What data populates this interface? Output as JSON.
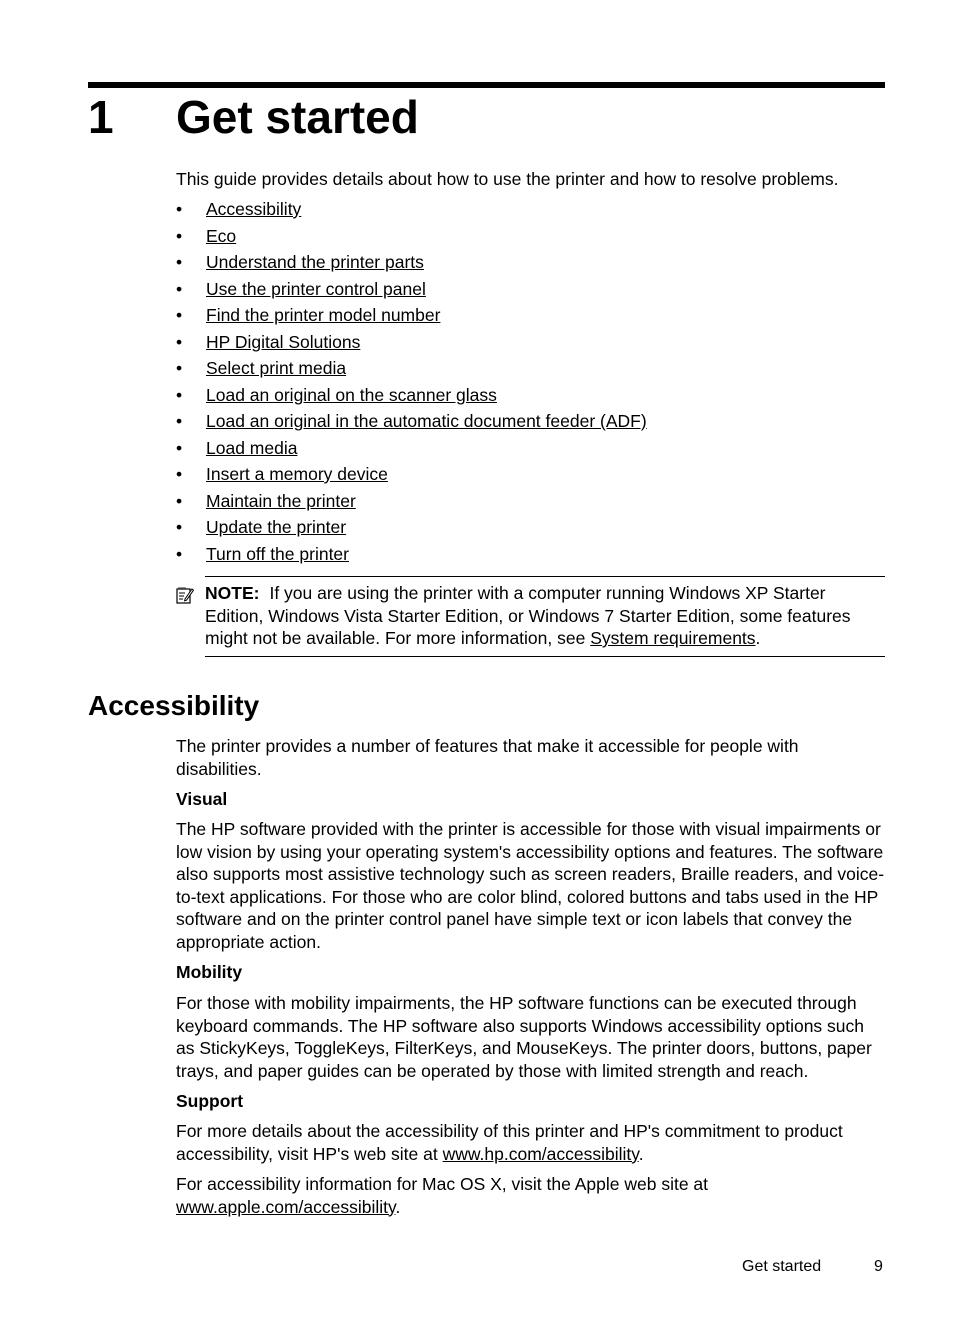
{
  "chapter": {
    "number": "1",
    "title": "Get started"
  },
  "intro": "This guide provides details about how to use the printer and how to resolve problems.",
  "toc": [
    "Accessibility",
    "Eco",
    "Understand the printer parts",
    "Use the printer control panel",
    "Find the printer model number",
    "HP Digital Solutions",
    "Select print media",
    "Load an original on the scanner glass",
    "Load an original in the automatic document feeder (ADF)",
    "Load media",
    "Insert a memory device",
    "Maintain the printer",
    "Update the printer",
    "Turn off the printer"
  ],
  "bullet": "•",
  "note": {
    "icon": "note-icon",
    "label": "NOTE:",
    "text": "If you are using the printer with a computer running Windows XP Starter Edition, Windows Vista Starter Edition, or Windows 7 Starter Edition, some features might not be available. For more information, see ",
    "link": "System requirements",
    "end": "."
  },
  "section": {
    "title": "Accessibility",
    "intro": "The printer provides a number of features that make it accessible for people with disabilities.",
    "visual": {
      "heading": "Visual",
      "text": "The HP software provided with the printer is accessible for those with visual impairments or low vision by using your operating system's accessibility options and features. The software also supports most assistive technology such as screen readers, Braille readers, and voice-to-text applications. For those who are color blind, colored buttons and tabs used in the HP software and on the printer control panel have simple text or icon labels that convey the appropriate action."
    },
    "mobility": {
      "heading": "Mobility",
      "text": "For those with mobility impairments, the HP software functions can be executed through keyboard commands. The HP software also supports Windows accessibility options such as StickyKeys, ToggleKeys, FilterKeys, and MouseKeys. The printer doors, buttons, paper trays, and paper guides can be operated by those with limited strength and reach."
    },
    "support": {
      "heading": "Support",
      "text1": "For more details about the accessibility of this printer and HP's commitment to product accessibility, visit HP's web site at ",
      "link1": "www.hp.com/accessibility",
      "end1": ".",
      "text2": "For accessibility information for Mac OS X, visit the Apple web site at ",
      "link2": "www.apple.com/accessibility",
      "end2": "."
    }
  },
  "footer": {
    "label": "Get started",
    "page": "9"
  }
}
